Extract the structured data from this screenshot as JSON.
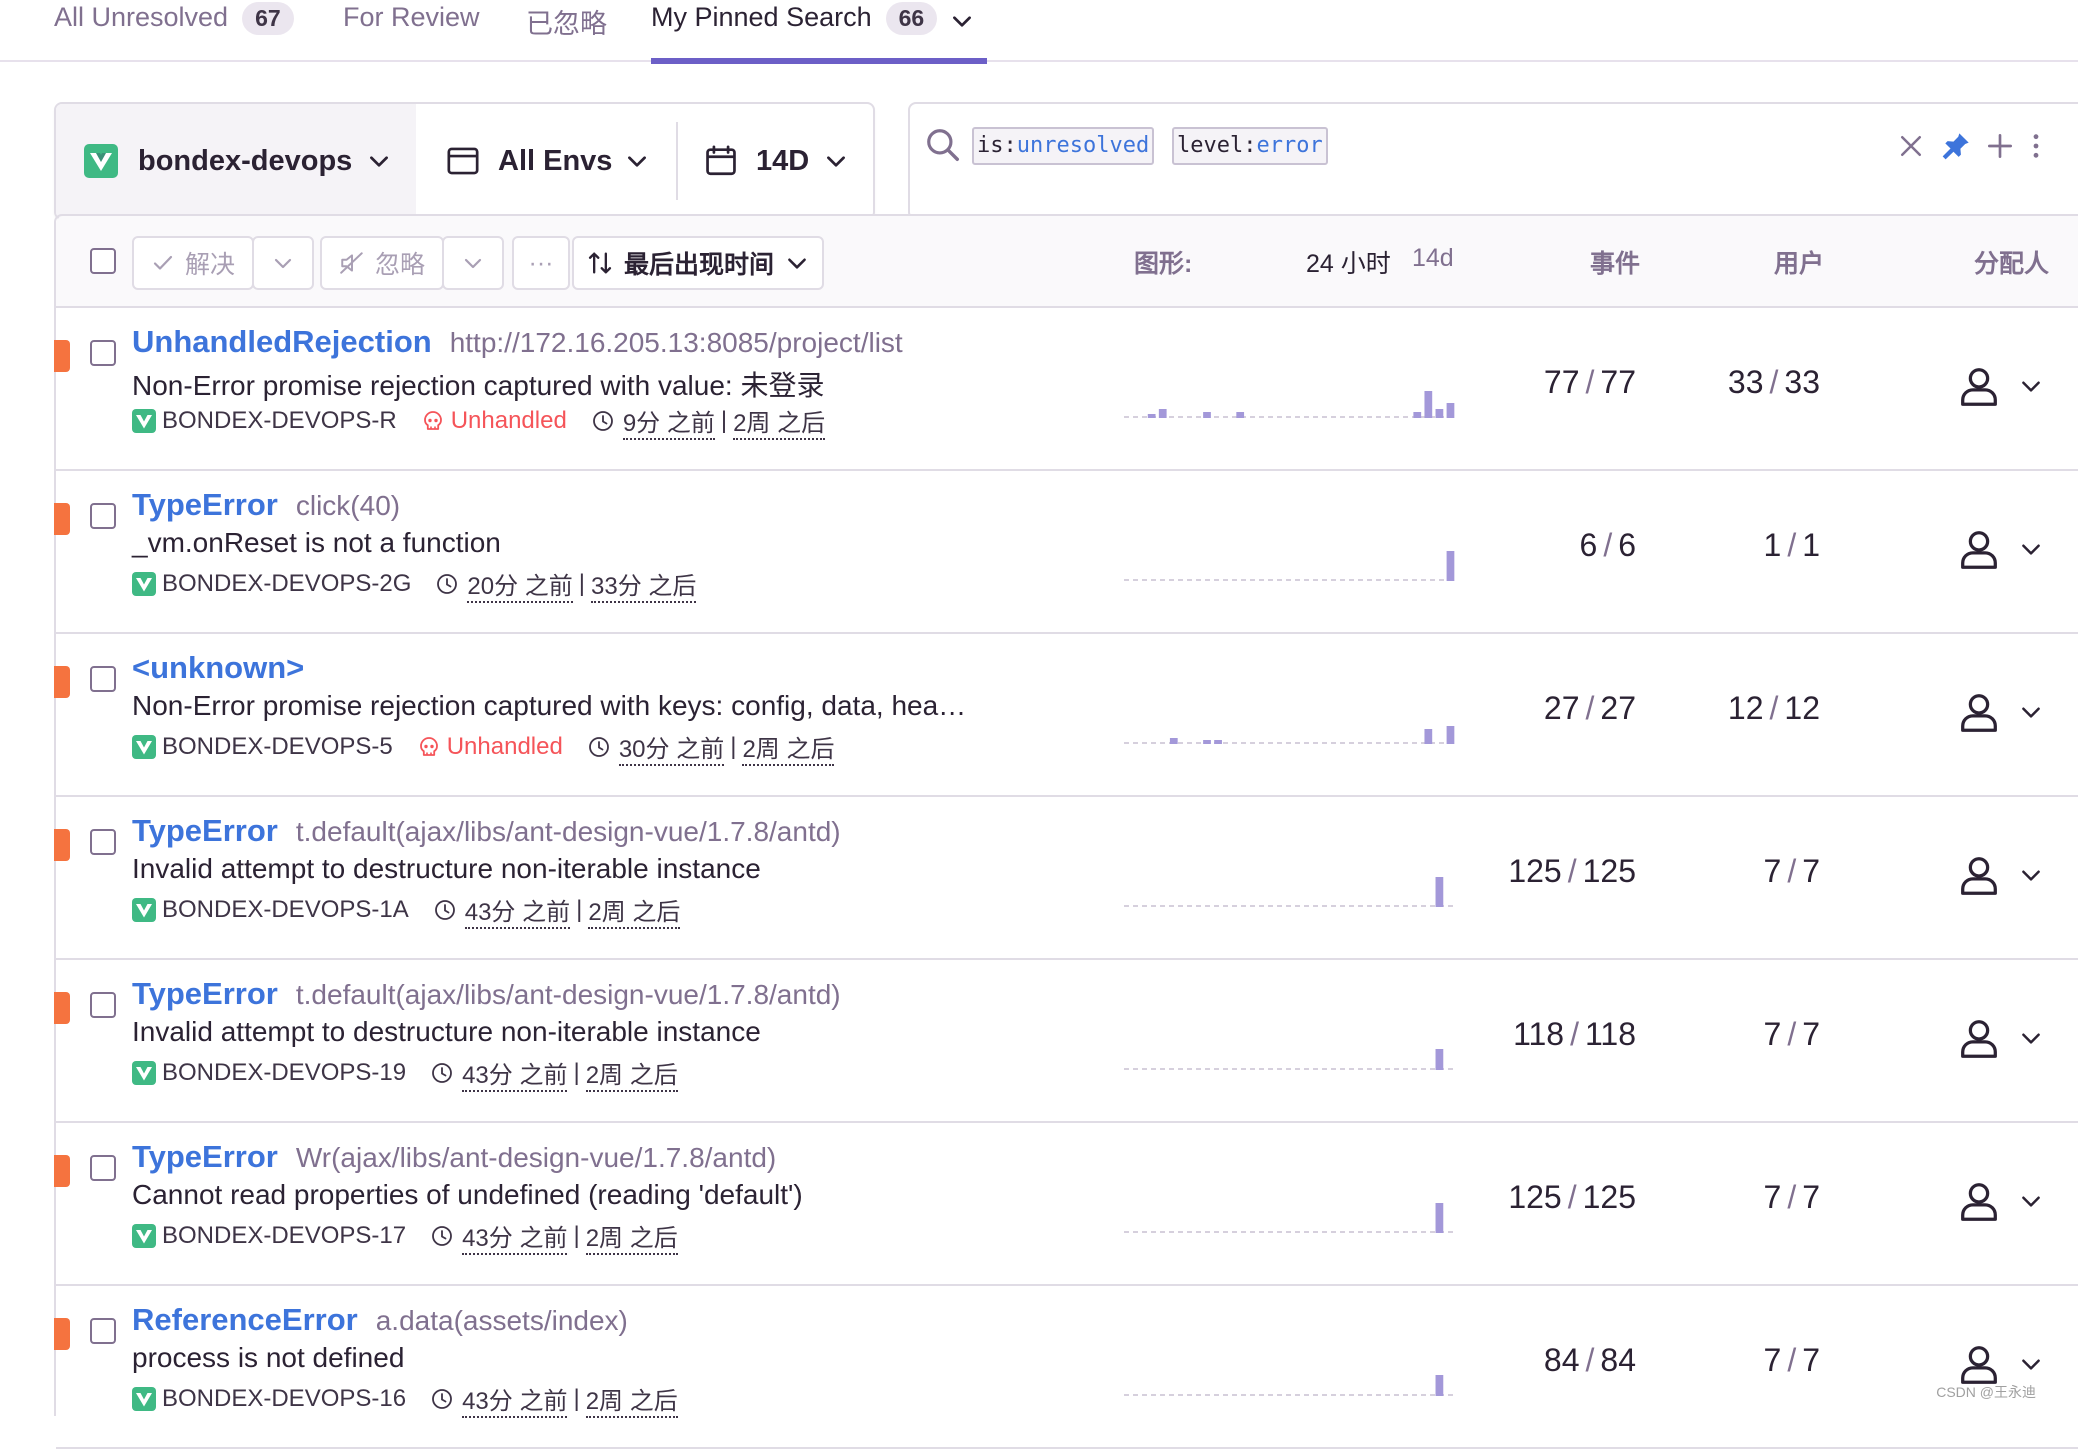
{
  "tabs": [
    {
      "label": "All Unresolved",
      "count": "67"
    },
    {
      "label": "For Review"
    },
    {
      "label": "已忽略"
    },
    {
      "label": "My Pinned Search",
      "count": "66"
    }
  ],
  "filters": {
    "project": "bondex-devops",
    "env": "All Envs",
    "period": "14D"
  },
  "search": {
    "tokens": [
      {
        "key": "is:",
        "value": "unresolved"
      },
      {
        "key": "level:",
        "value": "error"
      }
    ]
  },
  "toolbar": {
    "resolve": "解决",
    "ignore": "忽略",
    "more": "···",
    "sort": "最后出现时间",
    "graph_label": "图形:",
    "graph_24h": "24 小时",
    "graph_14d": "14d",
    "events": "事件",
    "users": "用户",
    "assignee": "分配人"
  },
  "issues": [
    {
      "type": "UnhandledRejection",
      "location": "http://172.16.205.13:8085/project/list",
      "message": "Non-Error promise rejection captured with value: 未登录",
      "short_id": "BONDEX-DEVOPS-R",
      "unhandled": "Unhandled",
      "first_seen": "9分 之前",
      "last_seen": "2周 之后",
      "events": "77",
      "events_total": "77",
      "users": "33",
      "users_total": "33",
      "spark": [
        0,
        0,
        1,
        3,
        0,
        0,
        0,
        2,
        0,
        0,
        2,
        0,
        0,
        0,
        0,
        0,
        0,
        0,
        0,
        0,
        0,
        0,
        0,
        0,
        0,
        0,
        2,
        9,
        3,
        5
      ]
    },
    {
      "type": "TypeError",
      "location": "click(40)",
      "message": "_vm.onReset is not a function",
      "short_id": "BONDEX-DEVOPS-2G",
      "first_seen": "20分 之前",
      "last_seen": "33分 之后",
      "events": "6",
      "events_total": "6",
      "users": "1",
      "users_total": "1",
      "spark": [
        0,
        0,
        0,
        0,
        0,
        0,
        0,
        0,
        0,
        0,
        0,
        0,
        0,
        0,
        0,
        0,
        0,
        0,
        0,
        0,
        0,
        0,
        0,
        0,
        0,
        0,
        0,
        0,
        0,
        10
      ]
    },
    {
      "type": "<unknown>",
      "location": "",
      "message": "Non-Error promise rejection captured with keys: config, data, hea…",
      "short_id": "BONDEX-DEVOPS-5",
      "unhandled": "Unhandled",
      "first_seen": "30分 之前",
      "last_seen": "2周 之后",
      "events": "27",
      "events_total": "27",
      "users": "12",
      "users_total": "12",
      "spark": [
        0,
        0,
        0,
        0,
        2,
        0,
        0,
        1,
        1,
        0,
        0,
        0,
        0,
        0,
        0,
        0,
        0,
        0,
        0,
        0,
        0,
        0,
        0,
        0,
        0,
        0,
        0,
        5,
        0,
        6
      ]
    },
    {
      "type": "TypeError",
      "location": "t.default(ajax/libs/ant-design-vue/1.7.8/antd)",
      "message": "Invalid attempt to destructure non-iterable instance",
      "short_id": "BONDEX-DEVOPS-1A",
      "first_seen": "43分 之前",
      "last_seen": "2周 之后",
      "events": "125",
      "events_total": "125",
      "users": "7",
      "users_total": "7",
      "spark": [
        0,
        0,
        0,
        0,
        0,
        0,
        0,
        0,
        0,
        0,
        0,
        0,
        0,
        0,
        0,
        0,
        0,
        0,
        0,
        0,
        0,
        0,
        0,
        0,
        0,
        0,
        0,
        0,
        10,
        0
      ]
    },
    {
      "type": "TypeError",
      "location": "t.default(ajax/libs/ant-design-vue/1.7.8/antd)",
      "message": "Invalid attempt to destructure non-iterable instance",
      "short_id": "BONDEX-DEVOPS-19",
      "first_seen": "43分 之前",
      "last_seen": "2周 之后",
      "events": "118",
      "events_total": "118",
      "users": "7",
      "users_total": "7",
      "spark": [
        0,
        0,
        0,
        0,
        0,
        0,
        0,
        0,
        0,
        0,
        0,
        0,
        0,
        0,
        0,
        0,
        0,
        0,
        0,
        0,
        0,
        0,
        0,
        0,
        0,
        0,
        0,
        0,
        7,
        0
      ]
    },
    {
      "type": "TypeError",
      "location": "Wr(ajax/libs/ant-design-vue/1.7.8/antd)",
      "message": "Cannot read properties of undefined (reading 'default')",
      "short_id": "BONDEX-DEVOPS-17",
      "first_seen": "43分 之前",
      "last_seen": "2周 之后",
      "events": "125",
      "events_total": "125",
      "users": "7",
      "users_total": "7",
      "spark": [
        0,
        0,
        0,
        0,
        0,
        0,
        0,
        0,
        0,
        0,
        0,
        0,
        0,
        0,
        0,
        0,
        0,
        0,
        0,
        0,
        0,
        0,
        0,
        0,
        0,
        0,
        0,
        0,
        10,
        0
      ]
    },
    {
      "type": "ReferenceError",
      "location": "a.data(assets/index)",
      "message": "process is not defined",
      "short_id": "BONDEX-DEVOPS-16",
      "first_seen": "43分 之前",
      "last_seen": "2周 之后",
      "events": "84",
      "events_total": "84",
      "users": "7",
      "users_total": "7",
      "spark": [
        0,
        0,
        0,
        0,
        0,
        0,
        0,
        0,
        0,
        0,
        0,
        0,
        0,
        0,
        0,
        0,
        0,
        0,
        0,
        0,
        0,
        0,
        0,
        0,
        0,
        0,
        0,
        0,
        7,
        0
      ]
    }
  ],
  "watermark": "CSDN @王永迪",
  "colors": {
    "accent": "#6c5fc7",
    "link": "#3d74db",
    "level_error": "#f5733f",
    "unhandled": "#f55459",
    "spark_bar": "#a398d9",
    "vue": "#3fb984"
  }
}
